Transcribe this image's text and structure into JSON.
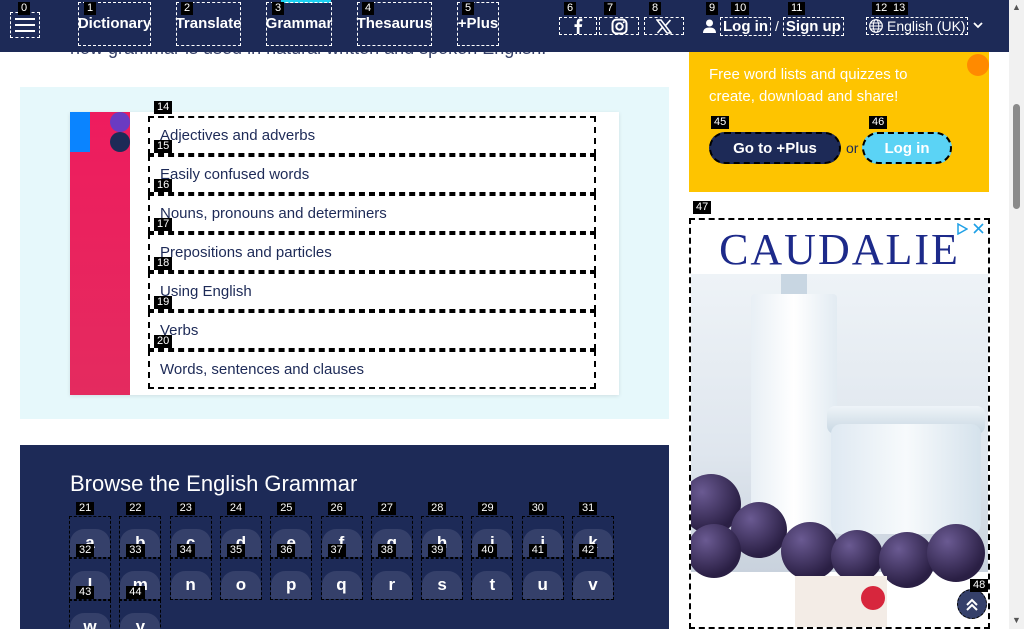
{
  "colors": {
    "navy": "#1d2a57",
    "accent": "#1dd1f1",
    "pink": "#ee1c5e",
    "promo": "#fec400"
  },
  "nav": {
    "tags": {
      "menu": "0",
      "dictionary": "1",
      "translate": "2",
      "grammar": "3",
      "thesaurus": "4",
      "plus": "5",
      "facebook": "6",
      "instagram": "7",
      "x": "8",
      "login": "9",
      "login_text": "10",
      "signup": "11",
      "lang_icon": "12",
      "lang": "13"
    },
    "dictionary": "Dictionary",
    "translate": "Translate",
    "grammar": "Grammar",
    "thesaurus": "Thesaurus",
    "plus": "+Plus",
    "login": "Log in",
    "separator": "/",
    "signup": "Sign up",
    "language": "English (UK)",
    "icons": [
      "menu-icon",
      "facebook-icon",
      "instagram-icon",
      "x-icon",
      "user-icon",
      "globe-icon",
      "chevron-down-icon"
    ]
  },
  "intro": "how grammar is used in natural written and spoken English.",
  "topics": {
    "tags": [
      "14",
      "15",
      "16",
      "17",
      "18",
      "19",
      "20"
    ],
    "items": [
      "Adjectives and adverbs",
      "Easily confused words",
      "Nouns, pronouns and determiners",
      "Prepositions and particles",
      "Using English",
      "Verbs",
      "Words, sentences and clauses"
    ]
  },
  "browse": {
    "title": "Browse the English Grammar",
    "tags": [
      "21",
      "22",
      "23",
      "24",
      "25",
      "26",
      "27",
      "28",
      "29",
      "30",
      "31",
      "32",
      "33",
      "34",
      "35",
      "36",
      "37",
      "38",
      "39",
      "40",
      "41",
      "42",
      "43",
      "44"
    ],
    "letters": [
      "a",
      "b",
      "c",
      "d",
      "e",
      "f",
      "g",
      "h",
      "i",
      "j",
      "k",
      "l",
      "m",
      "n",
      "o",
      "p",
      "q",
      "r",
      "s",
      "t",
      "u",
      "v",
      "w",
      "y"
    ]
  },
  "promo": {
    "text": "Free word lists and quizzes to create, download and share!",
    "plus_tag": "45",
    "plus": "Go to +Plus",
    "or": "or",
    "login_tag": "46",
    "login": "Log in"
  },
  "ad": {
    "tag": "47",
    "brand": "CAUDALIE",
    "scroll_tag": "48",
    "scroll_icon": "arrow-up-icon"
  }
}
